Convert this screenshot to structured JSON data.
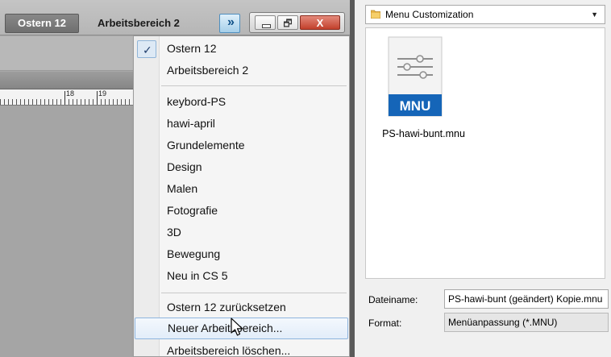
{
  "photoshop": {
    "workspace_active": "Ostern 12",
    "workspace_current": "Arbeitsbereich 2",
    "expand_glyph": "»",
    "maximize_glyph": "🗗",
    "close_glyph": "X",
    "ruler_labels": [
      "18",
      "19"
    ]
  },
  "workspace_menu": {
    "checked_item": "Ostern 12",
    "items_top": [
      "Arbeitsbereich 2"
    ],
    "items_saved": [
      "keybord-PS",
      "hawi-april",
      "Grundelemente",
      "Design",
      "Malen",
      "Fotografie",
      "3D",
      "Bewegung",
      "Neu in CS 5"
    ],
    "item_reset": "Ostern 12 zurücksetzen",
    "item_new": "Neuer Arbeitsbereich...",
    "item_delete": "Arbeitsbereich löschen...",
    "check_glyph": "✓"
  },
  "save_dialog": {
    "location": "Menu Customization",
    "file_item_label": "PS-hawi-bunt.mnu",
    "file_icon_text": "MNU",
    "filename_label": "Dateiname:",
    "filename_value": "PS-hawi-bunt (geändert) Kopie.mnu",
    "format_label": "Format:",
    "format_value": "Menüanpassung (*.MNU)",
    "colors": {
      "mnu_badge": "#1565b8",
      "highlight_border": "#8eb5de"
    }
  }
}
